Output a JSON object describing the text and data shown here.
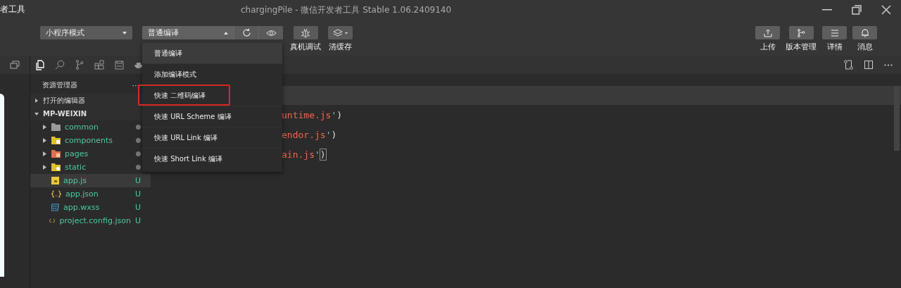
{
  "window": {
    "app_name": "者工具",
    "title": "chargingPile - 微信开发者工具 Stable 1.06.2409140"
  },
  "toolbar": {
    "mode_select": "小程序模式",
    "compile_select": "普通编译",
    "compile_menu_open": true,
    "tool_buttons": [
      {
        "label": "真机调试",
        "kind": "bug"
      },
      {
        "label": "清缓存",
        "kind": "layers"
      }
    ],
    "right_buttons": [
      {
        "label": "上传",
        "kind": "upload"
      },
      {
        "label": "版本管理",
        "kind": "branch"
      },
      {
        "label": "详情",
        "kind": "list"
      },
      {
        "label": "消息",
        "kind": "bell"
      }
    ]
  },
  "activity_bar": [
    {
      "kind": "files",
      "selected": true
    },
    {
      "kind": "search",
      "selected": false
    },
    {
      "kind": "git",
      "selected": false
    },
    {
      "kind": "extensions",
      "selected": false
    },
    {
      "kind": "save",
      "selected": false
    },
    {
      "kind": "docker",
      "selected": false
    }
  ],
  "explorer": {
    "title": "资源管理器",
    "more": "···",
    "sections": [
      {
        "label": "打开的编辑器",
        "expanded": false
      },
      {
        "label": "MP-WEIXIN",
        "expanded": true
      }
    ],
    "files": [
      {
        "name": "common",
        "kind": "folder-plain",
        "has_changes": true,
        "selected": false
      },
      {
        "name": "components",
        "kind": "folder-components",
        "has_changes": true,
        "selected": false
      },
      {
        "name": "pages",
        "kind": "folder-pages",
        "has_changes": true,
        "selected": false
      },
      {
        "name": "static",
        "kind": "folder-static",
        "has_changes": true,
        "selected": false
      },
      {
        "name": "app.js",
        "kind": "js",
        "status": "U",
        "selected": true
      },
      {
        "name": "app.json",
        "kind": "json",
        "status": "U",
        "selected": false
      },
      {
        "name": "app.wxss",
        "kind": "wxss",
        "status": "U",
        "selected": false
      },
      {
        "name": "project.config.json",
        "kind": "json",
        "status": "U",
        "selected": false
      }
    ]
  },
  "editor": {
    "lines": [
      {
        "string": "untime.js",
        "quote": "'",
        "paren": ")",
        "cursor": false,
        "bracket_match": false
      },
      {
        "string": "endor.js",
        "quote": "'",
        "paren": ")",
        "cursor": false,
        "bracket_match": false
      },
      {
        "string": "ain.js",
        "quote": "'",
        "paren": ")",
        "cursor": true,
        "bracket_match": true
      }
    ]
  },
  "compile_menu": [
    {
      "label": "普通编译",
      "selected": true,
      "outlined": false
    },
    {
      "label": "添加编译模式",
      "selected": false,
      "outlined": false
    },
    {
      "label": "快速 二维码编译",
      "selected": false,
      "outlined": true
    },
    {
      "label": "快速 URL Scheme 编译",
      "selected": false,
      "outlined": false
    },
    {
      "label": "快速 URL Link 编译",
      "selected": false,
      "outlined": false
    },
    {
      "label": "快速 Short Link 编译",
      "selected": false,
      "outlined": false
    }
  ]
}
